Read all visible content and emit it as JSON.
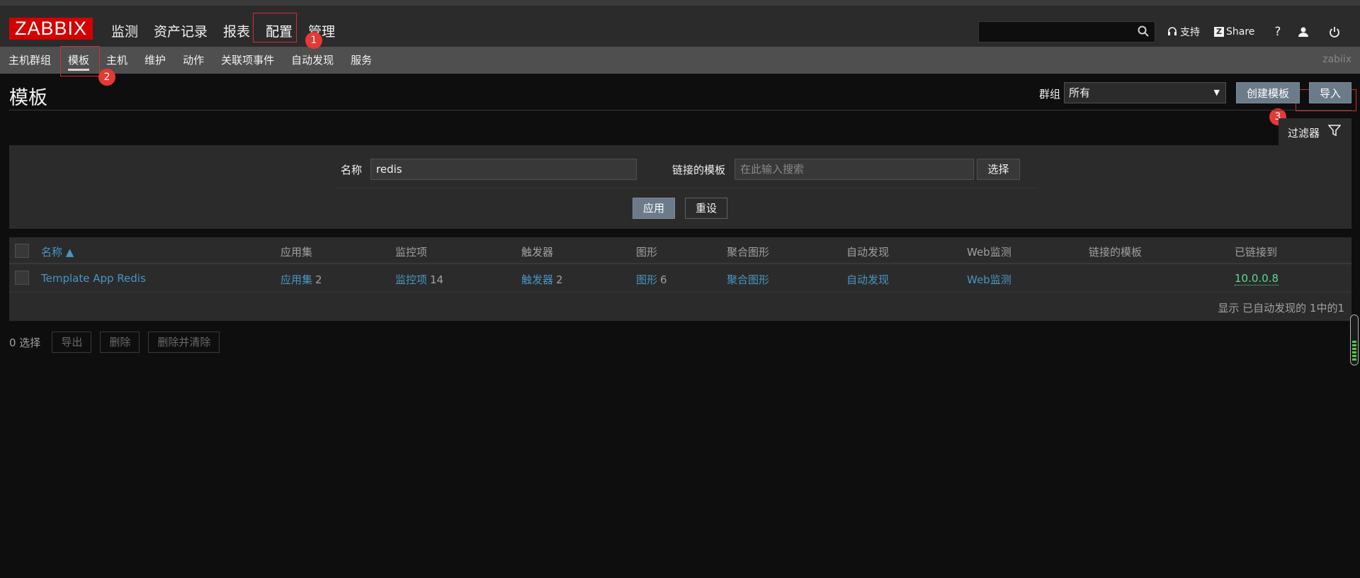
{
  "brand": {
    "logo_text": "ZABBIX",
    "logo_color": "#d40000"
  },
  "main_menu": [
    {
      "label": "监测"
    },
    {
      "label": "资产记录"
    },
    {
      "label": "报表"
    },
    {
      "label": "配置",
      "active": true
    },
    {
      "label": "管理"
    }
  ],
  "header": {
    "search_value": "",
    "support_label": "支持",
    "share_label": "Share",
    "help_label": "?",
    "user_icon": "user-icon",
    "logout_icon": "power-icon"
  },
  "sub_menu": [
    {
      "label": "主机群组"
    },
    {
      "label": "模板",
      "active": true
    },
    {
      "label": "主机"
    },
    {
      "label": "维护"
    },
    {
      "label": "动作"
    },
    {
      "label": "关联项事件"
    },
    {
      "label": "自动发现"
    },
    {
      "label": "服务"
    }
  ],
  "server_name": "zabiix",
  "annotations": [
    "1",
    "2",
    "3"
  ],
  "page": {
    "title": "模板",
    "group_label": "群组",
    "group_selected": "所有",
    "create_button": "创建模板",
    "import_button": "导入"
  },
  "filter": {
    "tab_label": "过滤器",
    "name_label": "名称",
    "name_value": "redis",
    "linked_label": "链接的模板",
    "linked_placeholder": "在此输入搜索",
    "select_button": "选择",
    "apply_button": "应用",
    "reset_button": "重设"
  },
  "table": {
    "columns": [
      "名称 ▲",
      "应用集",
      "监控项",
      "触发器",
      "图形",
      "聚合图形",
      "自动发现",
      "Web监测",
      "链接的模板",
      "已链接到"
    ],
    "rows": [
      {
        "name": "Template App Redis",
        "applications": "应用集",
        "applications_count": "2",
        "items": "监控项",
        "items_count": "14",
        "triggers": "触发器",
        "triggers_count": "2",
        "graphs": "图形",
        "graphs_count": "6",
        "screens": "聚合图形",
        "discovery": "自动发现",
        "web": "Web监测",
        "linked_templates": "",
        "linked_to": "10.0.0.8"
      }
    ],
    "footer": "显示 已自动发现的 1中的1"
  },
  "actions": {
    "selected_count": "0 选择",
    "export": "导出",
    "delete": "删除",
    "delete_clear": "删除并清除"
  },
  "colors": {
    "link": "#4796c4",
    "green": "#59db8f",
    "button": "#6b7b8a",
    "annotation": "#e53935"
  }
}
